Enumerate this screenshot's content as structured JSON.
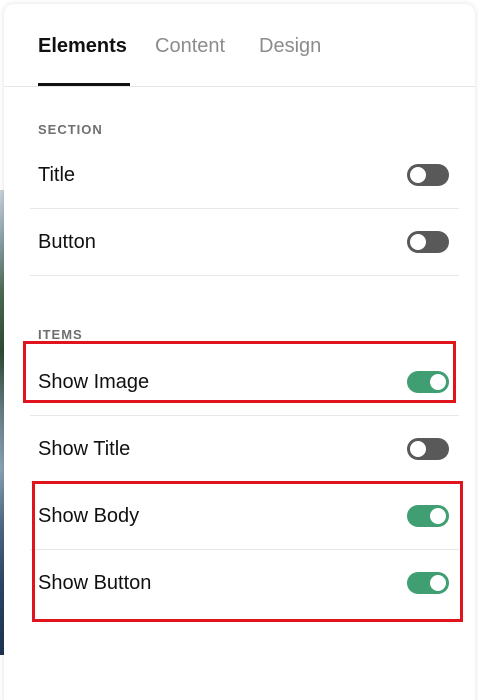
{
  "tabs": [
    {
      "label": "Elements",
      "active": true
    },
    {
      "label": "Content",
      "active": false
    },
    {
      "label": "Design",
      "active": false
    }
  ],
  "section": {
    "heading": "SECTION",
    "rows": [
      {
        "label": "Title",
        "enabled": false
      },
      {
        "label": "Button",
        "enabled": false
      }
    ]
  },
  "items": {
    "heading": "ITEMS",
    "rows": [
      {
        "label": "Show Image",
        "enabled": true
      },
      {
        "label": "Show Title",
        "enabled": false
      },
      {
        "label": "Show Body",
        "enabled": true
      },
      {
        "label": "Show Button",
        "enabled": true
      }
    ]
  },
  "colors": {
    "toggle_on": "#3f9f72",
    "toggle_off": "#595959",
    "highlight": "#e0141c"
  }
}
